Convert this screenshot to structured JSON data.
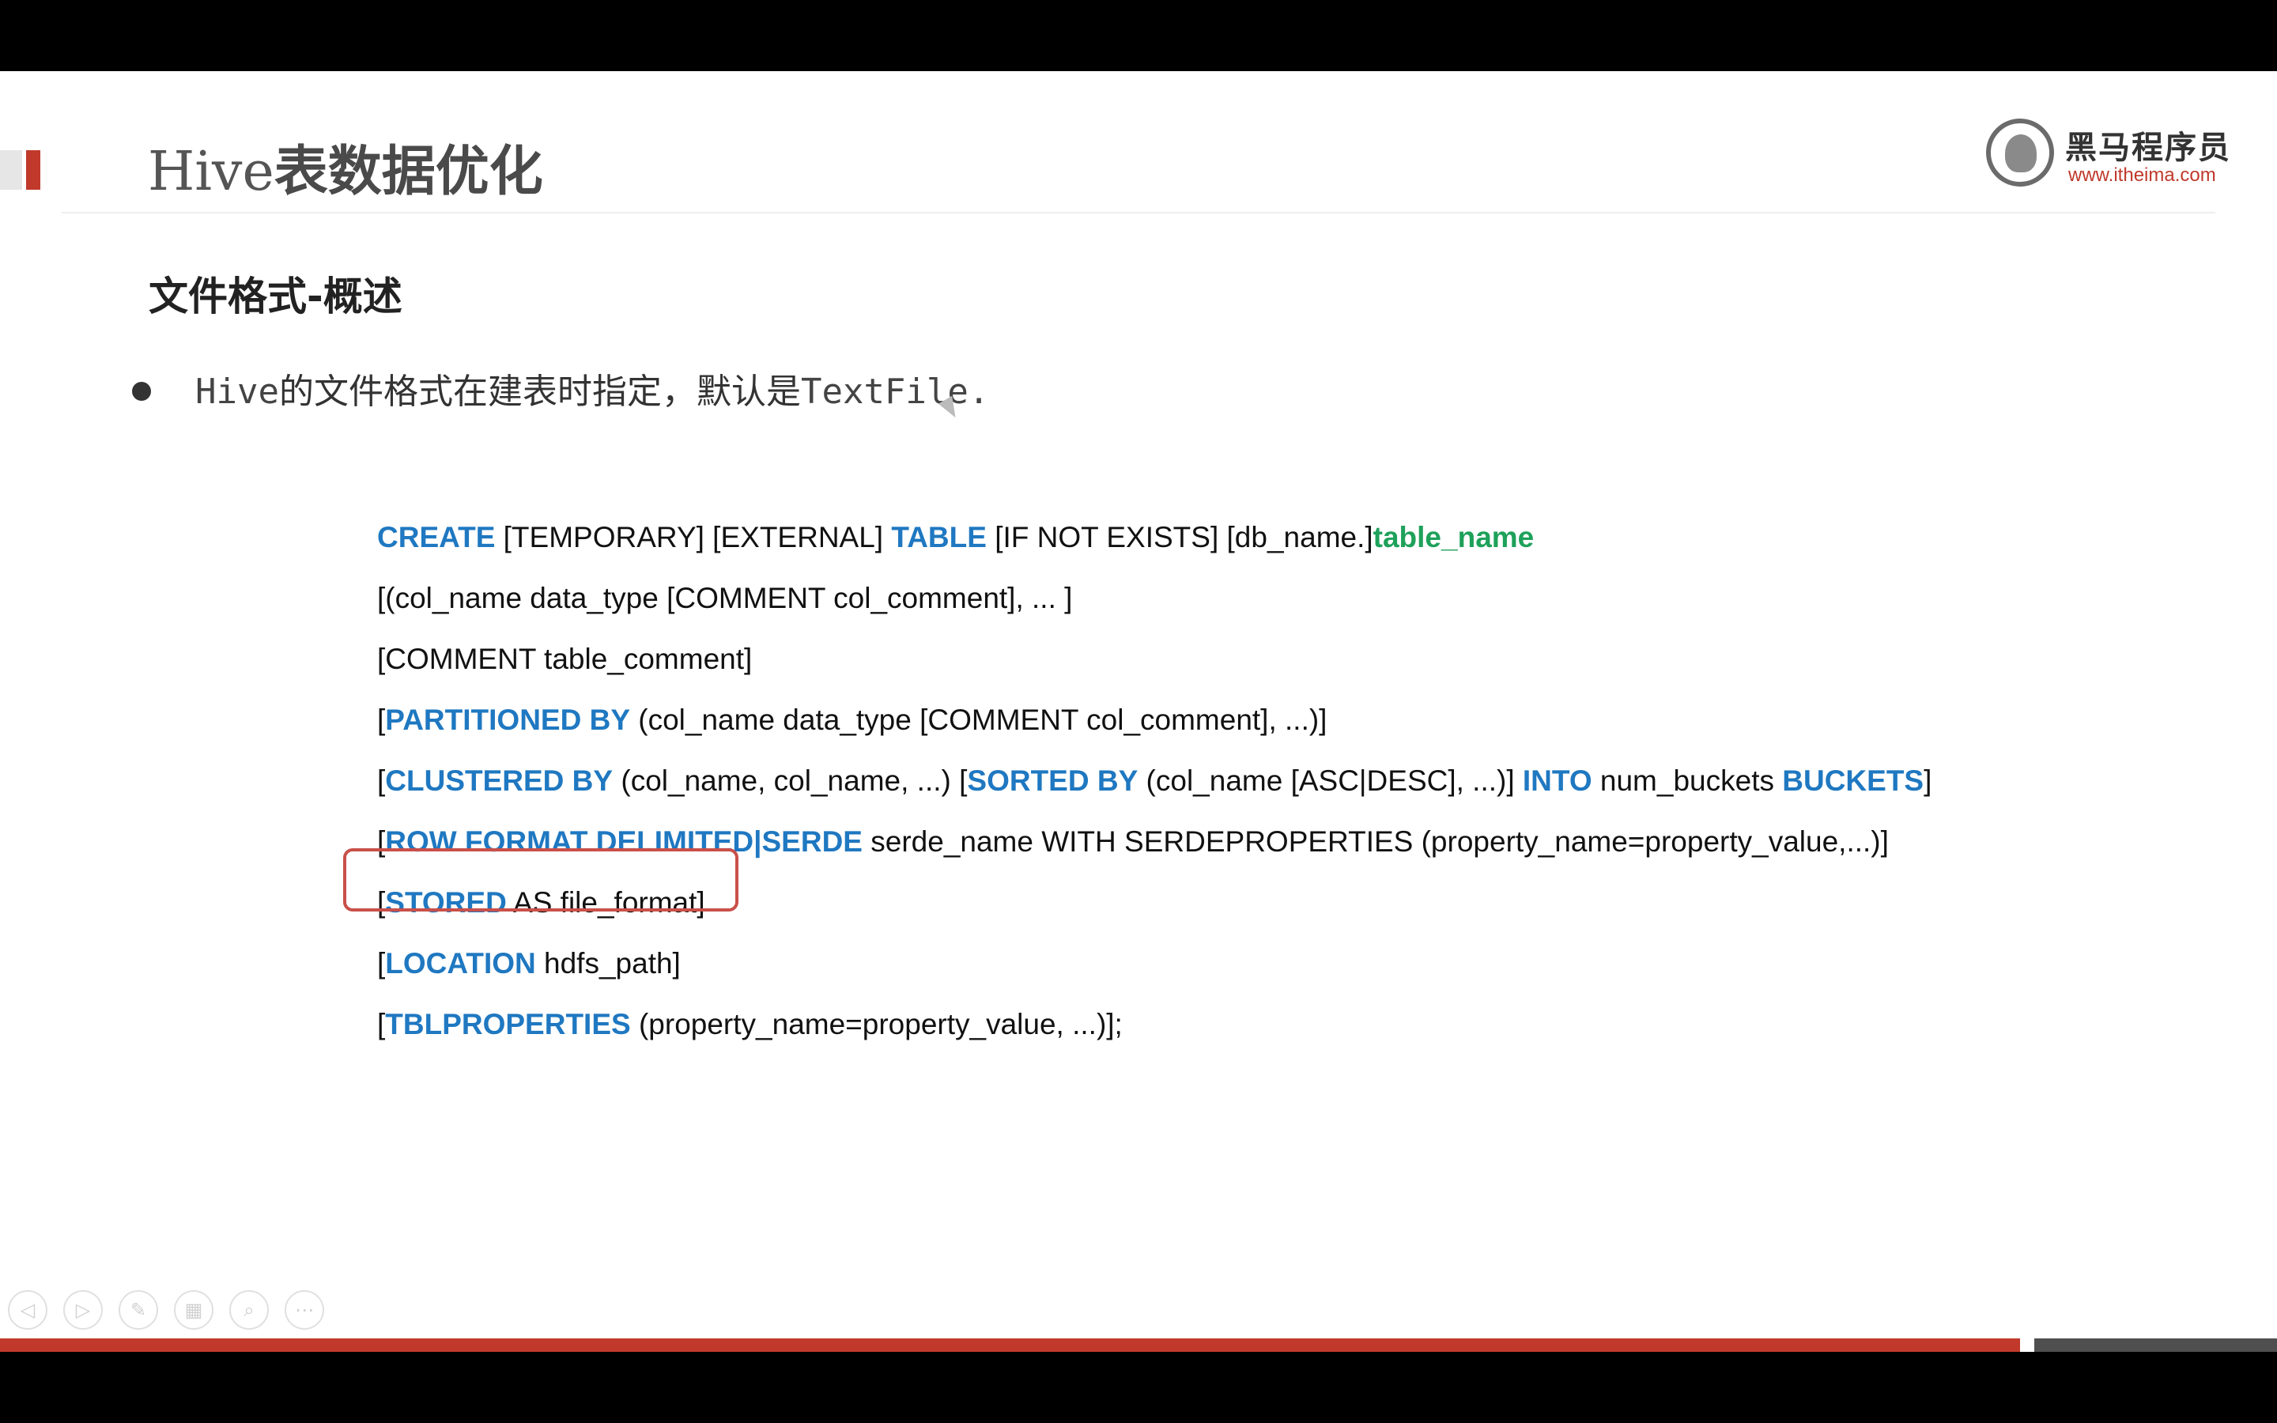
{
  "slide": {
    "title_latin": "Hive",
    "title_cn": "表数据优化",
    "logo": {
      "name": "黑马程序员",
      "url": "www.itheima.com"
    },
    "subtitle": "文件格式-概述",
    "bullet": {
      "part1": "Hive",
      "part2": "的文件格式在建表时指定，默认是",
      "part3": "TextFile."
    }
  },
  "code": {
    "line1": {
      "k1": "CREATE",
      "t1": " [TEMPORARY] [EXTERNAL] ",
      "k2": "TABLE",
      "t2": " [IF NOT EXISTS] [db_name.]",
      "tn": "table_name"
    },
    "line2": {
      "t1": "[(col_name data_type [COMMENT col_comment], ... ]"
    },
    "line3": {
      "t1": "[COMMENT table_comment]"
    },
    "line4": {
      "t1": "[",
      "k1": "PARTITIONED BY",
      "t2": " (col_name data_type [COMMENT col_comment], ...)]"
    },
    "line5": {
      "t1": "[",
      "k1": "CLUSTERED BY",
      "t2": " (col_name, col_name, ...) [",
      "k2": "SORTED BY",
      "t3": " (col_name [ASC|DESC], ...)] ",
      "k3": "INTO",
      "t4": " num_buckets ",
      "k4": "BUCKETS",
      "t5": "]"
    },
    "line6": {
      "t1": "[",
      "k1": "ROW FORMAT DELIMITED|SERDE",
      "t2": " serde_name WITH SERDEPROPERTIES (property_name=property_value,...)]"
    },
    "line7": {
      "t1": "[",
      "k1": "STORED",
      "t2": " AS file_format]"
    },
    "line8": {
      "t1": "[",
      "k1": "LOCATION",
      "t2": " hdfs_path]"
    },
    "line9": {
      "t1": "[",
      "k1": "TBLPROPERTIES",
      "t2": " (property_name=property_value, ...)];"
    }
  },
  "toolbar": {
    "icons": [
      "previous-icon",
      "next-icon",
      "pen-icon",
      "slides-icon",
      "zoom-icon",
      "more-icon"
    ],
    "glyphs": {
      "prev": "◁",
      "next": "▷",
      "pen": "✎",
      "slides": "▦",
      "zoom": "⌕",
      "more": "⋯"
    }
  },
  "colors": {
    "keyword": "#1f78c1",
    "table_name": "#1ea15a",
    "accent_red": "#c0392b",
    "highlight_box": "#c9504a"
  }
}
